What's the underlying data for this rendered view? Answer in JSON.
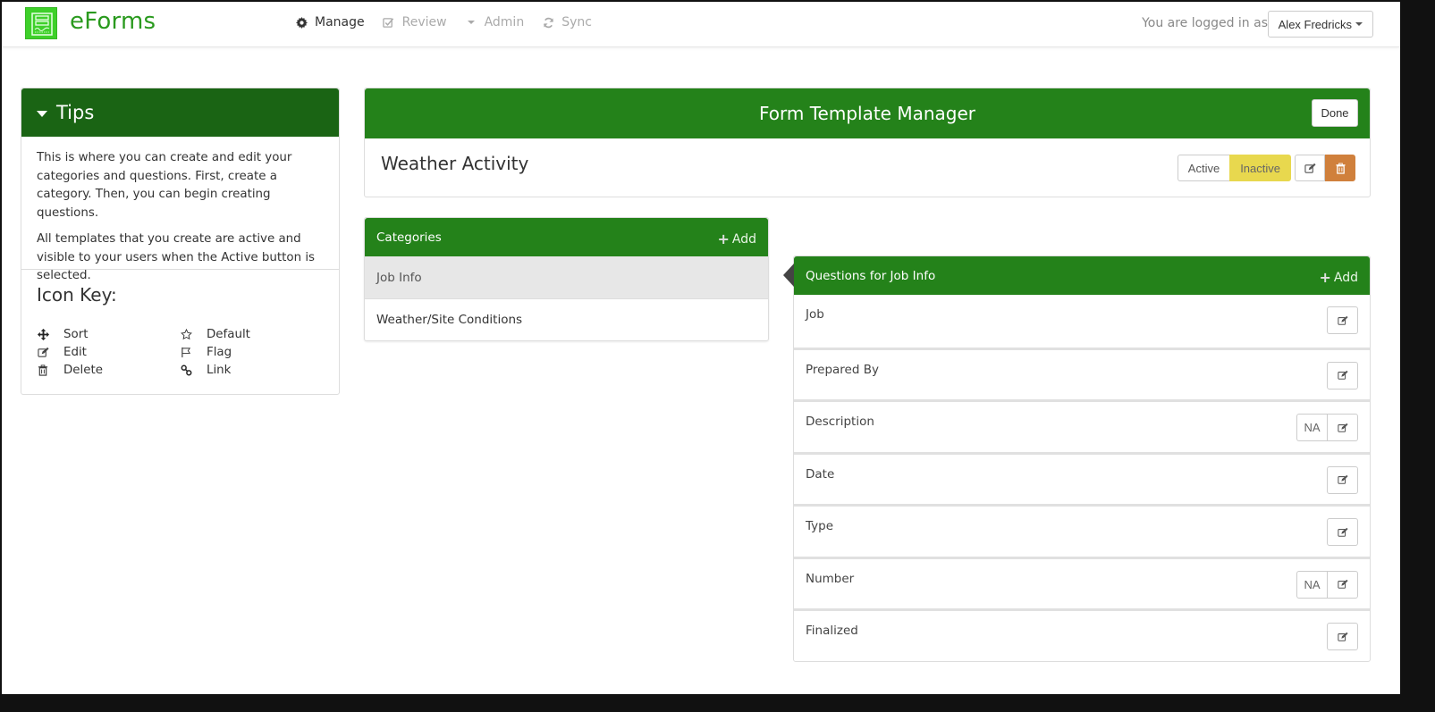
{
  "app": {
    "brand": "eForms",
    "brand_color": "#2a9a1e",
    "accent_green": "#24821a",
    "dark_green": "#1a6414"
  },
  "nav": {
    "items": [
      {
        "label": "Manage",
        "icon": "gear-icon",
        "active": true
      },
      {
        "label": "Review",
        "icon": "check-square-icon",
        "active": false
      },
      {
        "label": "Admin",
        "icon": "caret-down-icon",
        "active": false
      },
      {
        "label": "Sync",
        "icon": "refresh-icon",
        "active": false
      }
    ],
    "logged_in_text": "You are logged in as",
    "user_name": "Alex Fredricks"
  },
  "tips": {
    "title": "Tips",
    "paragraphs": [
      "This is where you can create and edit your categories and questions. First, create a category. Then, you can begin creating questions.",
      "All templates that you create are active and visible to your users when the Active button is selected."
    ],
    "icon_key_title": "Icon Key:",
    "icon_key": [
      {
        "label": "Sort",
        "icon": "move-icon"
      },
      {
        "label": "Default",
        "icon": "star-icon"
      },
      {
        "label": "Edit",
        "icon": "edit-icon"
      },
      {
        "label": "Flag",
        "icon": "flag-icon"
      },
      {
        "label": "Delete",
        "icon": "trash-icon"
      },
      {
        "label": "Link",
        "icon": "link-icon"
      }
    ]
  },
  "manager": {
    "title": "Form Template Manager",
    "done_label": "Done",
    "form_name": "Weather Activity",
    "status": {
      "active_label": "Active",
      "inactive_label": "Inactive",
      "selected": "Inactive",
      "inactive_color": "#e8d84e"
    },
    "delete_color": "#d0803c"
  },
  "categories": {
    "title": "Categories",
    "add_label": "Add",
    "items": [
      {
        "label": "Job Info",
        "selected": true
      },
      {
        "label": "Weather/Site Conditions",
        "selected": false
      }
    ]
  },
  "questions": {
    "title": "Questions for Job Info",
    "add_label": "Add",
    "na_label": "NA",
    "items": [
      {
        "label": "Job",
        "has_na": false
      },
      {
        "label": "Prepared By",
        "has_na": false
      },
      {
        "label": "Description",
        "has_na": true
      },
      {
        "label": "Date",
        "has_na": false
      },
      {
        "label": "Type",
        "has_na": false
      },
      {
        "label": "Number",
        "has_na": true
      },
      {
        "label": "Finalized",
        "has_na": false
      }
    ]
  }
}
